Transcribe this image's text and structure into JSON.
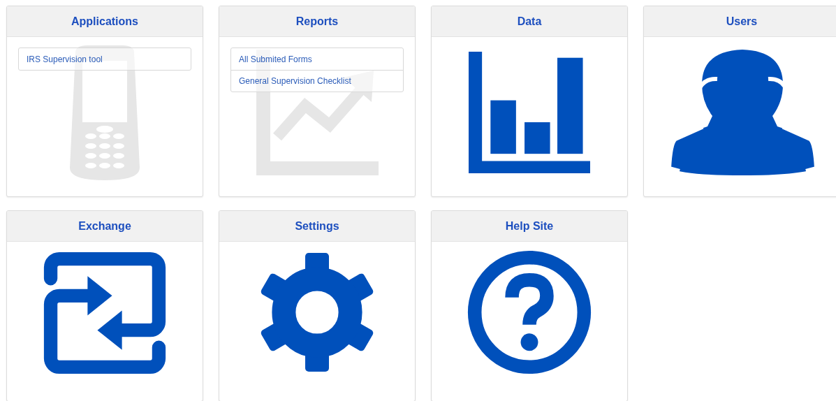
{
  "cards": [
    {
      "title": "Applications",
      "links": [
        "IRS Supervision tool"
      ]
    },
    {
      "title": "Reports",
      "links": [
        "All Submited Forms",
        "General Supervision Checklist"
      ]
    },
    {
      "title": "Data"
    },
    {
      "title": "Users"
    },
    {
      "title": "Exchange"
    },
    {
      "title": "Settings"
    },
    {
      "title": "Help Site"
    }
  ]
}
